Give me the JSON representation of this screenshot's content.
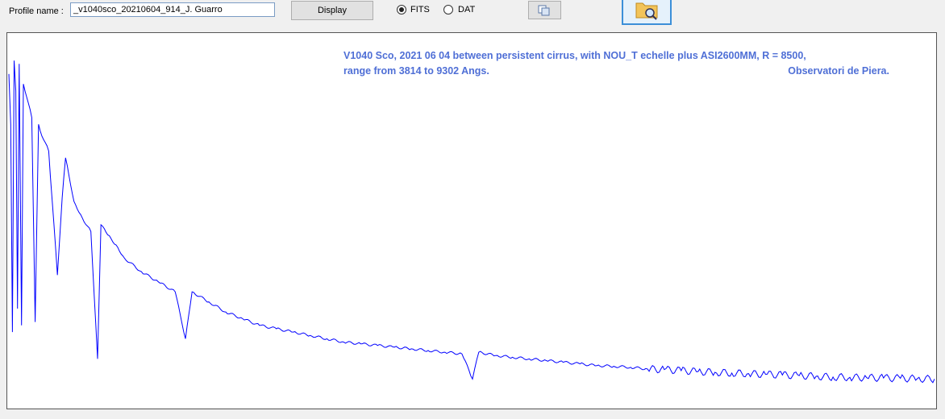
{
  "toolbar": {
    "profile_label": "Profile name :",
    "profile_value": "_v1040sco_20210604_914_J. Guarro",
    "display_label": "Display",
    "format_options": [
      {
        "label": "FITS",
        "selected": true
      },
      {
        "label": "DAT",
        "selected": false
      }
    ],
    "copy_icon": "copy-icon",
    "open_icon": "folder-search-icon"
  },
  "plot": {
    "title_line1": "V1040 Sco, 2021 06 04 between persistent cirrus, with NOU_T echelle plus ASI2600MM, R = 8500,",
    "title_line2_left": "range from 3814 to 9302 Angs.",
    "title_line2_right": "Observatori de Piera.",
    "line_color": "#0000ff",
    "text_color": "#4f6fd6"
  },
  "chart_data": {
    "type": "line",
    "xlim": [
      3814,
      9302
    ],
    "series": [
      {
        "x": [
          3814,
          3825,
          3835,
          3845,
          3855,
          3865,
          3875,
          3889,
          3900,
          3920,
          3950,
          3970,
          3990,
          4000,
          4050,
          4102,
          4130,
          4150,
          4200,
          4250,
          4300,
          4340,
          4360,
          4400,
          4450,
          4500,
          4600,
          4700,
          4800,
          4861,
          4900,
          5000,
          5100,
          5200,
          5300,
          5400,
          5500,
          5600,
          5700,
          5800,
          5900,
          6000,
          6100,
          6200,
          6300,
          6400,
          6500,
          6563,
          6600,
          6700,
          6800,
          6900,
          7000,
          7100,
          7200,
          7300,
          7400,
          7500,
          7600,
          7700,
          7800,
          7900,
          8000,
          8100,
          8200,
          8300,
          8400,
          8500,
          8600,
          8700,
          8800,
          8900,
          9000,
          9100,
          9200,
          9302
        ],
        "y": [
          0.95,
          0.8,
          0.18,
          0.99,
          0.9,
          0.25,
          0.98,
          0.2,
          0.92,
          0.88,
          0.82,
          0.21,
          0.8,
          0.78,
          0.72,
          0.35,
          0.58,
          0.7,
          0.57,
          0.52,
          0.48,
          0.1,
          0.5,
          0.47,
          0.44,
          0.4,
          0.36,
          0.33,
          0.3,
          0.16,
          0.3,
          0.27,
          0.24,
          0.22,
          0.2,
          0.19,
          0.18,
          0.17,
          0.16,
          0.15,
          0.145,
          0.14,
          0.135,
          0.13,
          0.125,
          0.12,
          0.115,
          0.04,
          0.12,
          0.11,
          0.105,
          0.1,
          0.095,
          0.09,
          0.085,
          0.08,
          0.078,
          0.075,
          0.07,
          0.068,
          0.065,
          0.062,
          0.06,
          0.058,
          0.056,
          0.054,
          0.052,
          0.05,
          0.048,
          0.046,
          0.045,
          0.044,
          0.043,
          0.042,
          0.041,
          0.04
        ]
      }
    ]
  }
}
